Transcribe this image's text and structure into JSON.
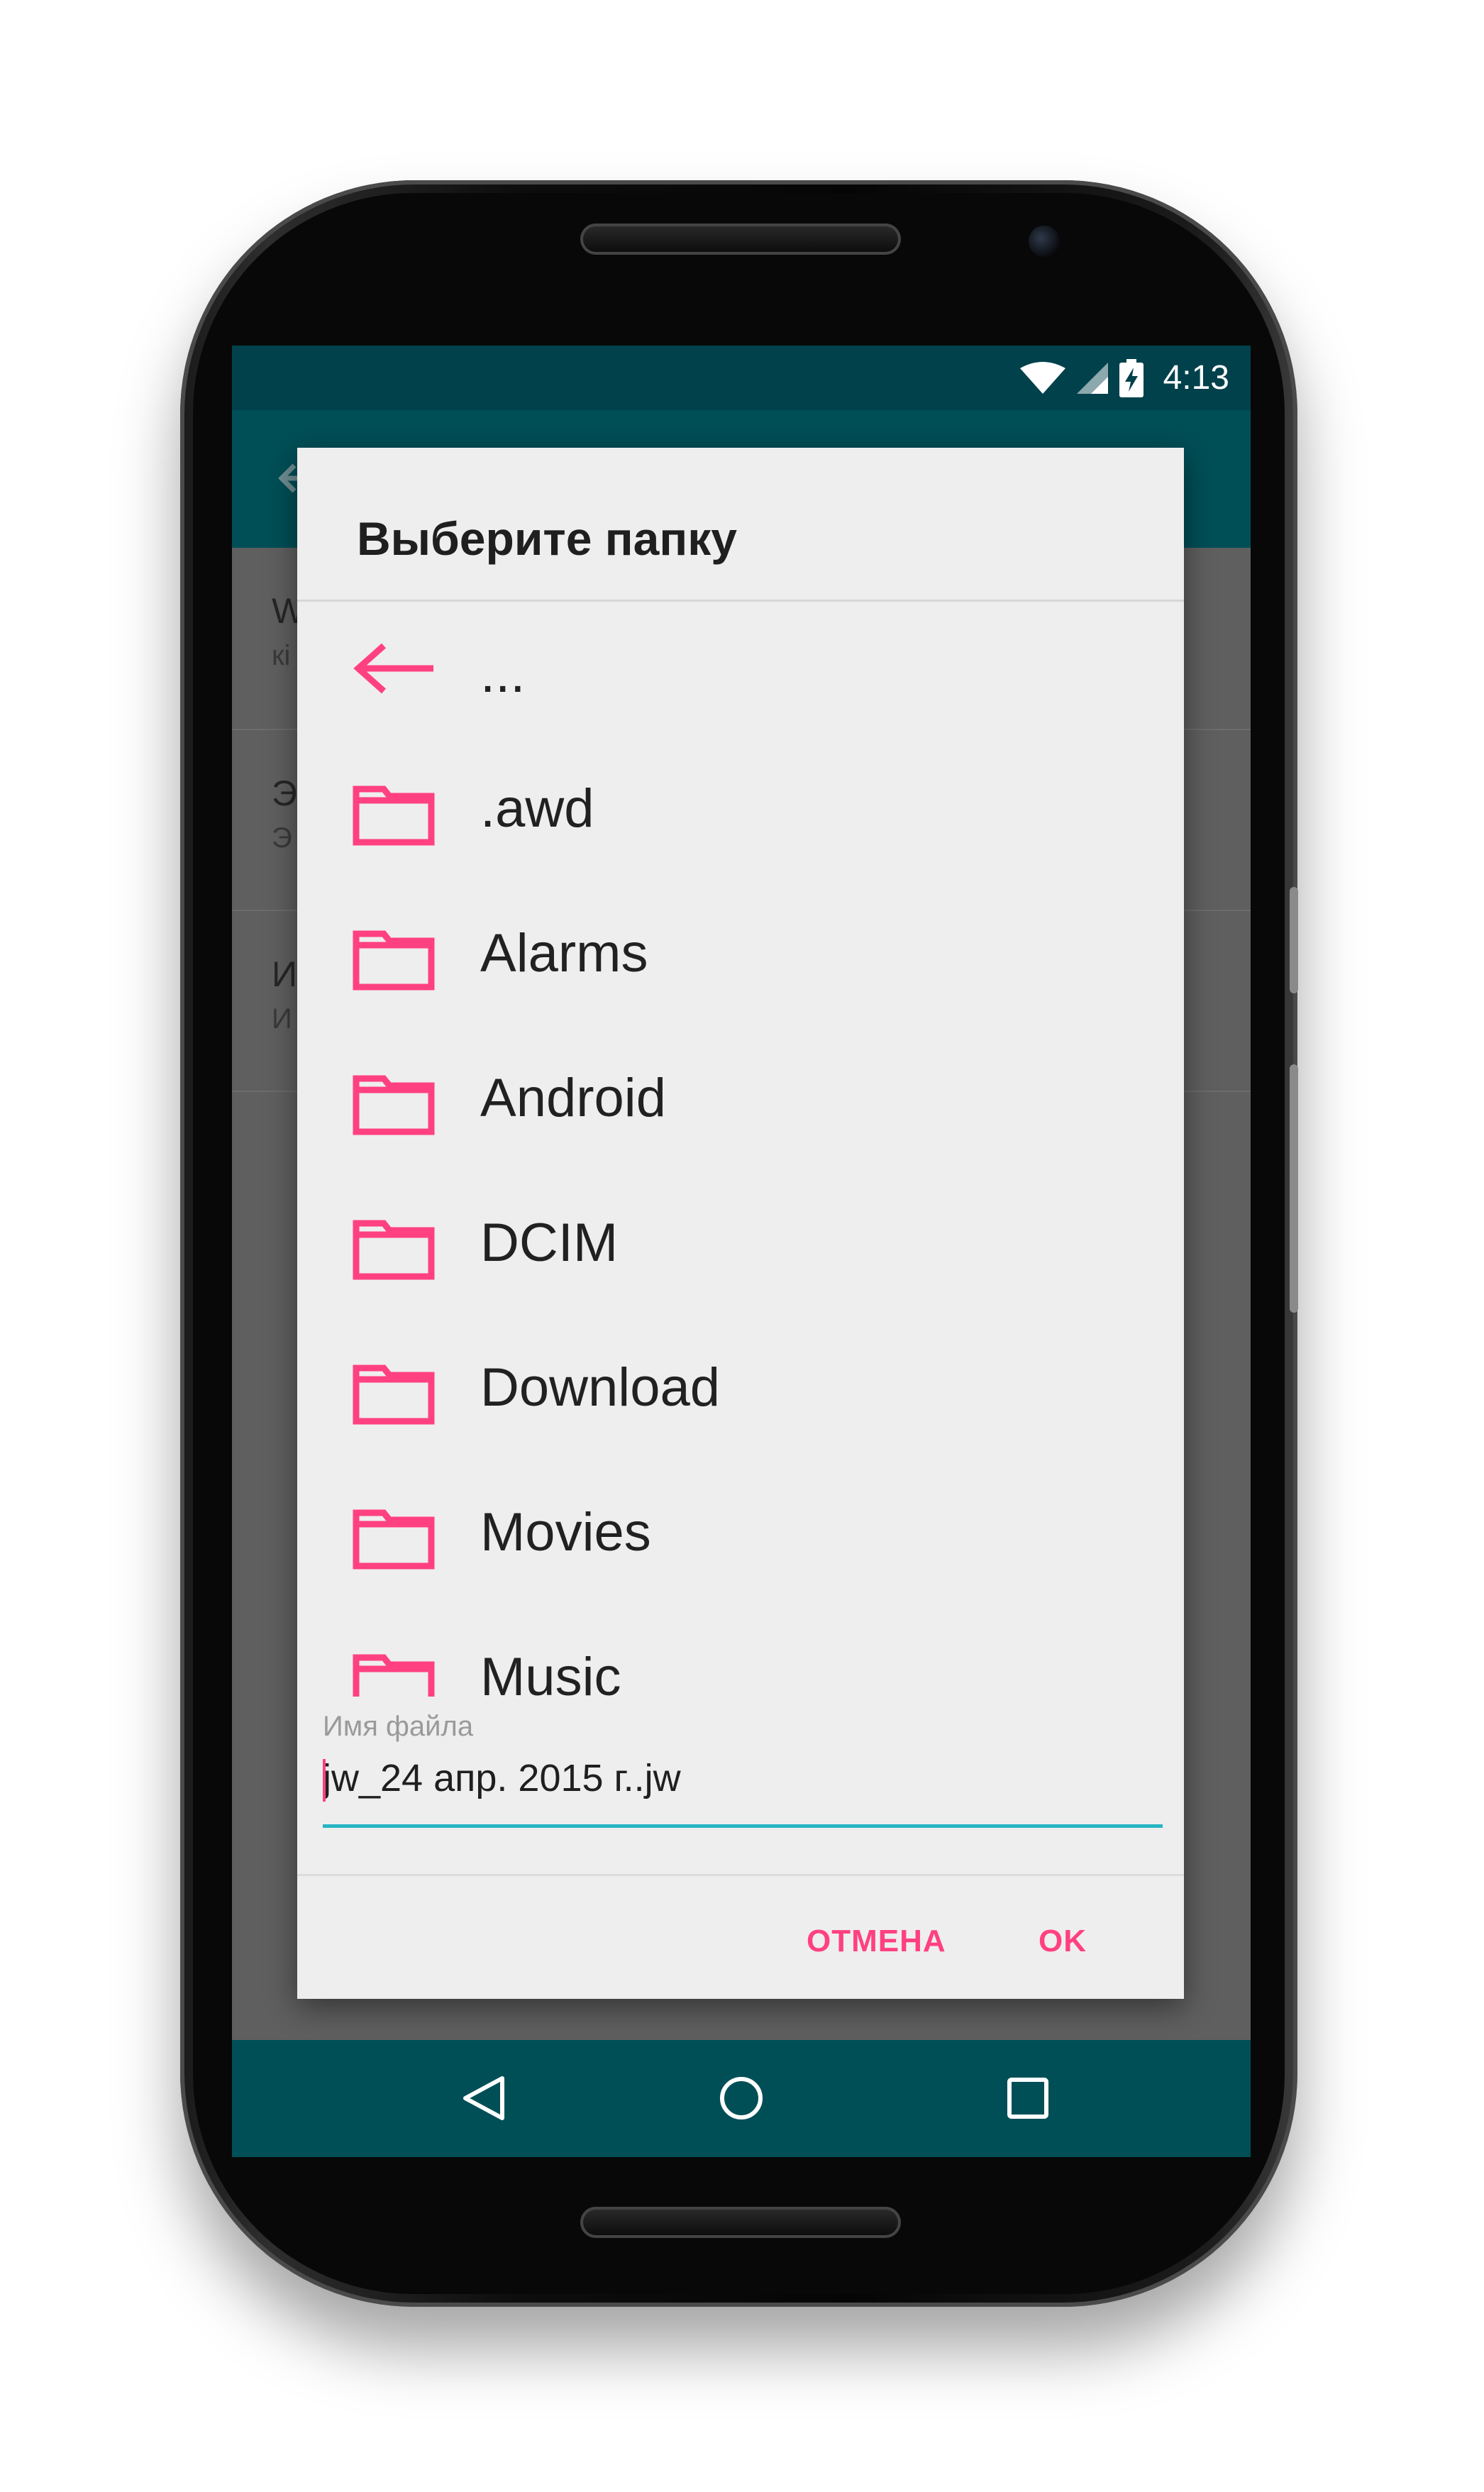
{
  "status_bar": {
    "time": "4:13",
    "icons": [
      "wifi-icon",
      "signal-icon",
      "battery-charging-icon"
    ]
  },
  "background_screen": {
    "rows": [
      {
        "title": "W",
        "subtitle": "кі"
      },
      {
        "title": "Э",
        "subtitle": "Э"
      },
      {
        "title": "И",
        "subtitle": "И"
      }
    ]
  },
  "dialog": {
    "title": "Выберите папку",
    "up_entry": {
      "icon": "arrow-back-icon",
      "label": "..."
    },
    "folders": [
      {
        "label": ".awd",
        "icon": "folder-icon"
      },
      {
        "label": "Alarms",
        "icon": "folder-icon"
      },
      {
        "label": "Android",
        "icon": "folder-icon"
      },
      {
        "label": "DCIM",
        "icon": "folder-icon"
      },
      {
        "label": "Download",
        "icon": "folder-icon"
      },
      {
        "label": "Movies",
        "icon": "folder-icon"
      },
      {
        "label": "Music",
        "icon": "folder-icon"
      }
    ],
    "filename_field": {
      "label": "Имя файла",
      "value": "jw_24 апр. 2015 г..jw"
    },
    "buttons": {
      "cancel": "ОТМЕНА",
      "ok": "OK"
    }
  },
  "nav_bar": {
    "icons": [
      "back-triangle-icon",
      "home-circle-icon",
      "recents-square-icon"
    ]
  },
  "colors": {
    "accent": "#ff4081",
    "status_bar": "#00414c",
    "app_bar": "#004f57",
    "input_underline": "#26b5c4",
    "dialog_bg": "#eeeeee"
  }
}
